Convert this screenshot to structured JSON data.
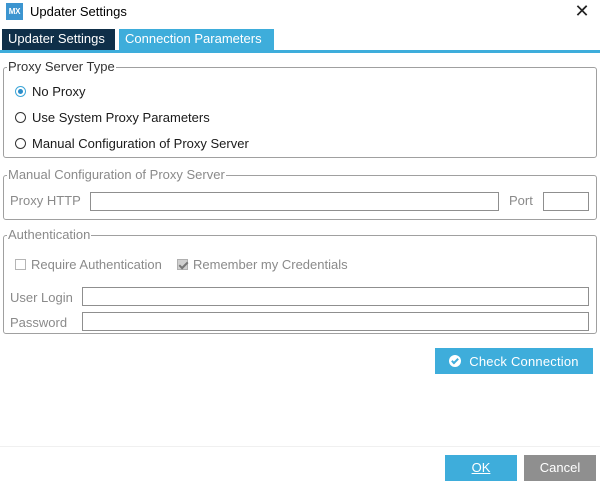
{
  "window": {
    "app_icon_text": "MX",
    "title": "Updater Settings",
    "close_glyph": "✕"
  },
  "tabs": [
    {
      "label": "Updater Settings",
      "active": false
    },
    {
      "label": "Connection Parameters",
      "active": true
    }
  ],
  "proxy_type": {
    "legend": "Proxy Server Type",
    "options": [
      {
        "label": "No Proxy",
        "selected": true
      },
      {
        "label": "Use System Proxy Parameters",
        "selected": false
      },
      {
        "label": "Manual Configuration of Proxy Server",
        "selected": false
      }
    ]
  },
  "manual_config": {
    "legend": "Manual Configuration of Proxy Server",
    "proxy_http_label": "Proxy HTTP",
    "proxy_http_value": "",
    "port_label": "Port",
    "port_value": ""
  },
  "authentication": {
    "legend": "Authentication",
    "require_auth_label": "Require Authentication",
    "require_auth_checked": false,
    "remember_label": "Remember my Credentials",
    "remember_checked": true,
    "user_login_label": "User Login",
    "user_login_value": "",
    "password_label": "Password",
    "password_value": ""
  },
  "check_connection_label": "Check Connection",
  "footer": {
    "ok_label": "OK",
    "cancel_label": "Cancel"
  },
  "colors": {
    "accent": "#3eaddb",
    "tab_dark": "#0f2f49",
    "cancel_gray": "#8f8f8f",
    "disabled_text": "#8a8a8a"
  },
  "icons": {
    "app": "mx-app-icon",
    "close": "close-icon",
    "check_connection": "check-circle-icon"
  }
}
